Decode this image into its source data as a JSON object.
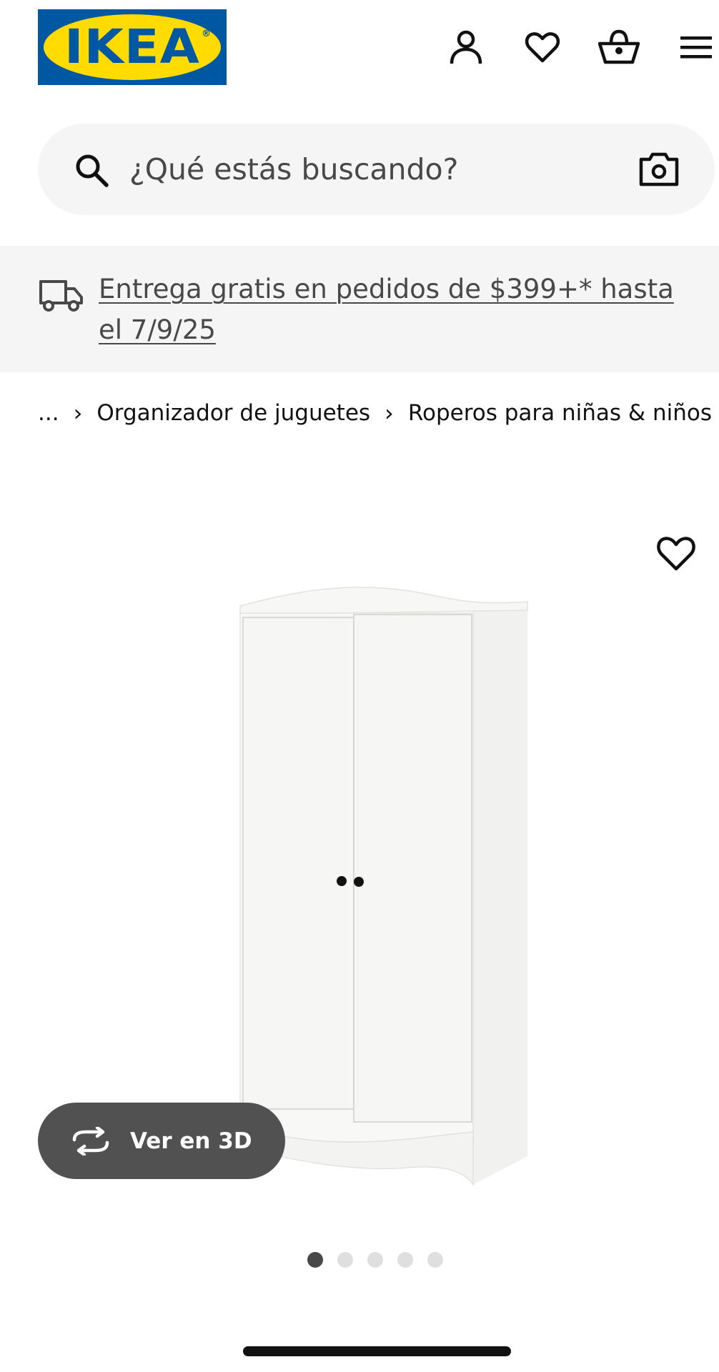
{
  "header": {
    "logo_text": "IKEA",
    "logo_reg": "®",
    "icons": [
      "account-icon",
      "heart-icon",
      "cart-icon",
      "menu-icon"
    ]
  },
  "search": {
    "placeholder": "¿Qué estás buscando?"
  },
  "promo": {
    "text": "Entrega gratis en pedidos de $399+* hasta el 7/9/25"
  },
  "breadcrumb": {
    "ellipsis": "...",
    "items": [
      "Organizador de juguetes",
      "Roperos para niñas & niños"
    ]
  },
  "gallery": {
    "view_3d_label": "Ver en 3D",
    "image_count": 5,
    "active_index": 0
  },
  "colors": {
    "brand_blue": "#0058a3",
    "brand_yellow": "#ffdb00",
    "surface_gray": "#f5f5f5",
    "text_dark": "#111111",
    "button_dark": "#484848"
  }
}
